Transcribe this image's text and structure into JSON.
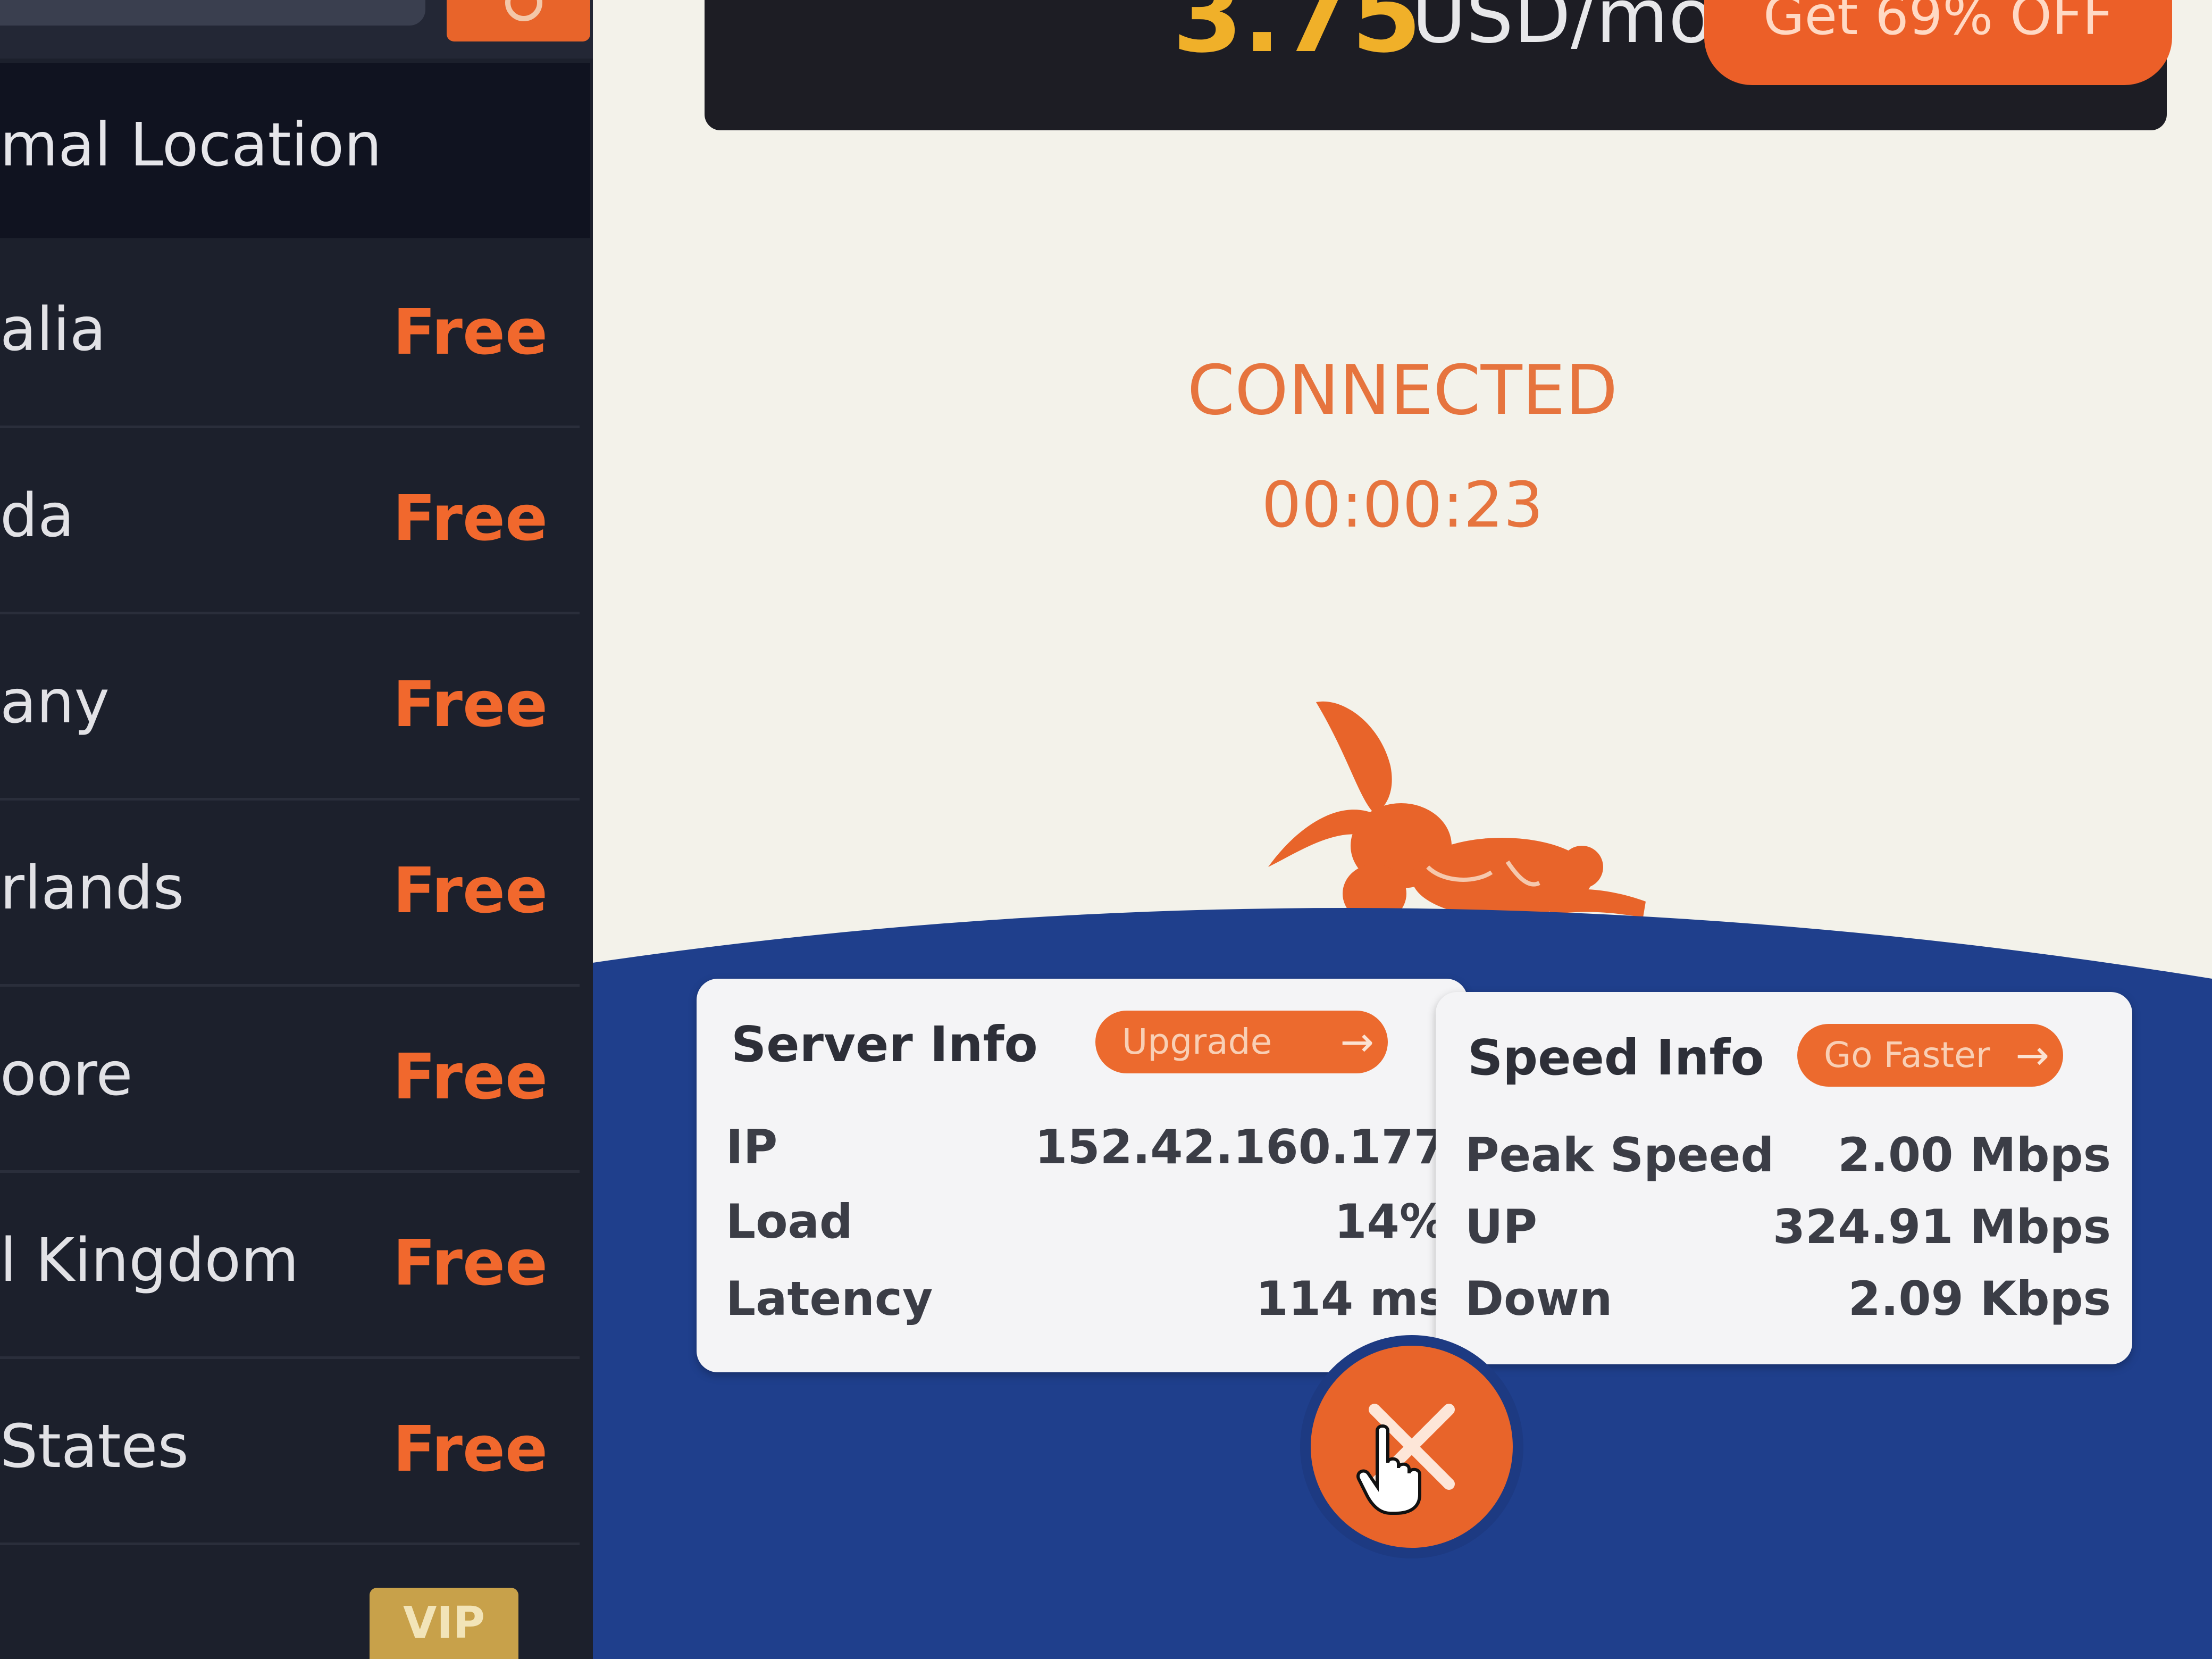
{
  "sidebar": {
    "header_label": "mal Location",
    "servers": [
      {
        "name": "alia",
        "tag": "Free"
      },
      {
        "name": "da",
        "tag": "Free"
      },
      {
        "name": "any",
        "tag": "Free"
      },
      {
        "name": "rlands",
        "tag": "Free"
      },
      {
        "name": "oore",
        "tag": "Free"
      },
      {
        "name": "l Kingdom",
        "tag": "Free"
      },
      {
        "name": "States",
        "tag": "Free"
      }
    ],
    "vip_label": "VIP"
  },
  "promo": {
    "price": "3.75",
    "unit": "USD/mo",
    "deal_label": "Get 69% OFF"
  },
  "connection": {
    "status": "CONNECTED",
    "elapsed": "00:00:23"
  },
  "server_info": {
    "title": "Server Info",
    "button_label": "Upgrade",
    "ip_label": "IP",
    "ip_value": "152.42.160.177",
    "load_label": "Load",
    "load_value": "14%",
    "latency_label": "Latency",
    "latency_value": "114 ms"
  },
  "speed_info": {
    "title": "Speed Info",
    "button_label": "Go Faster",
    "peak_label": "Peak Speed",
    "peak_value": "2.00 Mbps",
    "up_label": "UP",
    "up_value": "324.91 Mbps",
    "down_label": "Down",
    "down_value": "2.09 Kbps"
  },
  "icons": {
    "disconnect": "close-icon",
    "cursor": "hand-pointer-icon",
    "arrow": "arrow-right-icon",
    "mascot": "rabbit-mascot"
  },
  "colors": {
    "accent": "#e8642a",
    "wave": "#1f3f8c",
    "sidebar": "#1c202c",
    "vip": "#c8a14a"
  }
}
